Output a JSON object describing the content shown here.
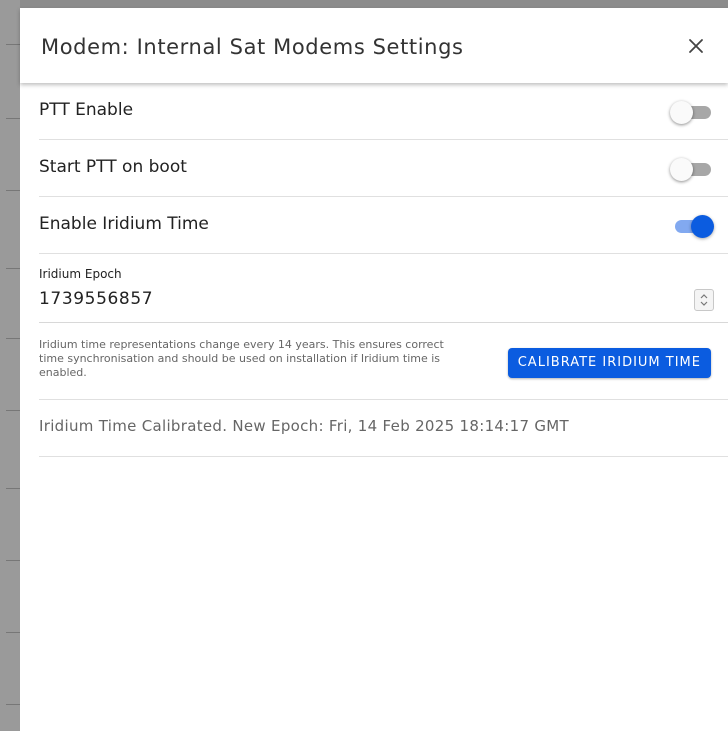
{
  "dialog": {
    "title": "Modem: Internal Sat Modems Settings",
    "close_icon": "close-icon"
  },
  "settings": {
    "ptt_enable": {
      "label": "PTT Enable",
      "checked": false
    },
    "start_ptt_on_boot": {
      "label": "Start PTT on boot",
      "checked": false
    },
    "enable_iridium_time": {
      "label": "Enable Iridium Time",
      "checked": true
    }
  },
  "iridium_epoch": {
    "label": "Iridium Epoch",
    "value": "1739556857"
  },
  "calibration": {
    "help_text": "Iridium time representations change every 14 years. This ensures correct time synchronisation and should be used on installation if Iridium time is enabled.",
    "button_label": "CALIBRATE IRIDIUM TIME"
  },
  "status": {
    "message": "Iridium Time Calibrated. New Epoch: Fri, 14 Feb 2025 18:14:17 GMT"
  },
  "colors": {
    "accent": "#0b5ce0",
    "switch_off_track": "#a7a7a7",
    "switch_on_track": "#82a9f0"
  }
}
